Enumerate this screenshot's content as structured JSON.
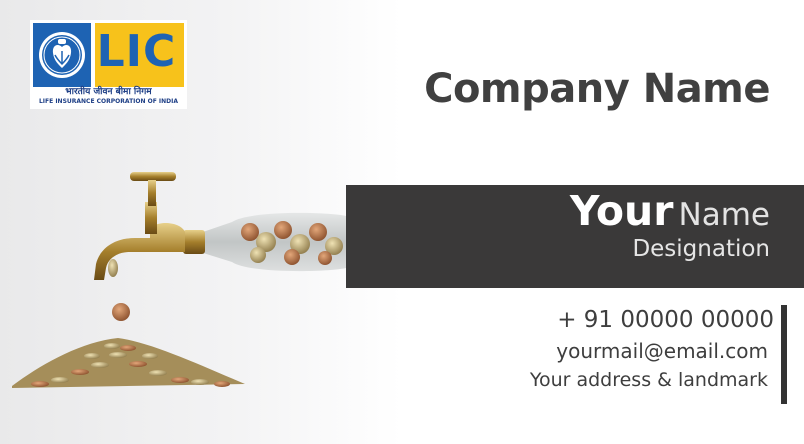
{
  "logo": {
    "brand": "LIC",
    "hindi": "भारतीय जीवन बीमा निगम",
    "english": "LIFE INSURANCE CORPORATION OF INDIA",
    "colors": {
      "blue": "#1e63b3",
      "yellow": "#f7c21b"
    }
  },
  "company_name": "Company Name",
  "person": {
    "first": "Your",
    "last": "Name",
    "designation": "Designation"
  },
  "contact": {
    "phone": "+ 91 00000 00000",
    "email": "yourmail@email.com",
    "address": "Your address & landmark"
  },
  "colors": {
    "band": "#3a3939",
    "text": "#404040"
  },
  "illustration": {
    "icon": "tap-with-coins-icon"
  }
}
